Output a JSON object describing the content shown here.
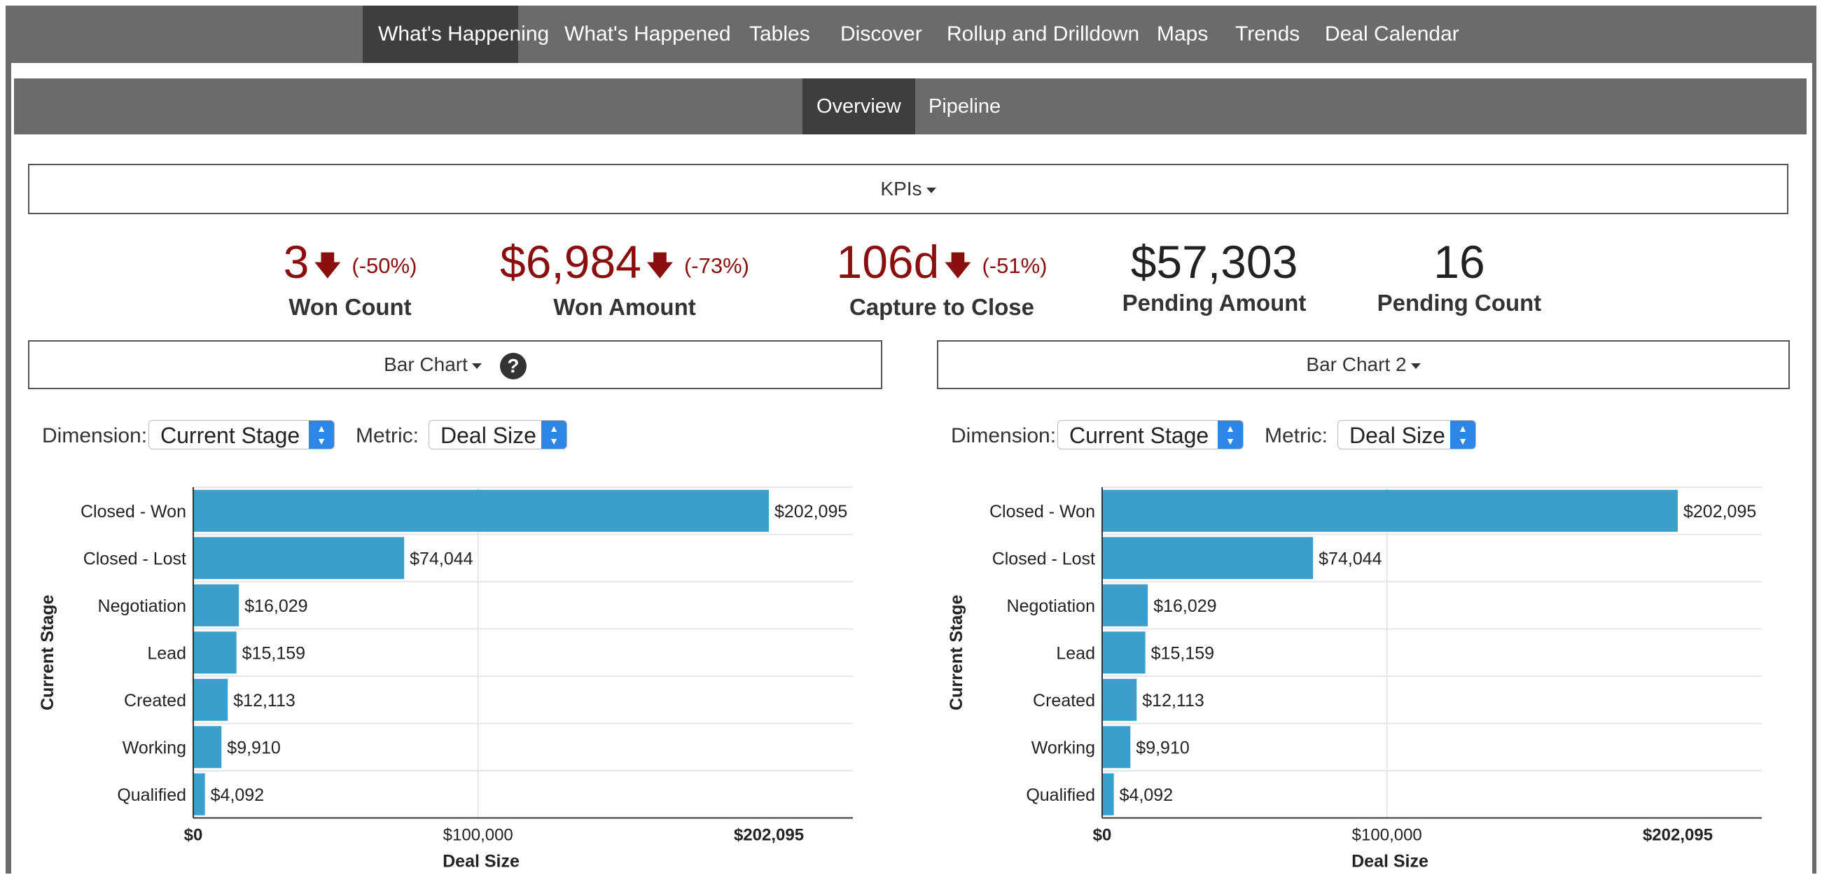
{
  "topnav": {
    "items": [
      "What's Happening",
      "What's Happened",
      "Tables",
      "Discover",
      "Rollup and Drilldown",
      "Maps",
      "Trends",
      "Deal Calendar"
    ]
  },
  "subnav": {
    "items": [
      "Overview",
      "Pipeline"
    ]
  },
  "kpis_header": "KPIs",
  "kpis": [
    {
      "value": "3",
      "pct": "(-50%)",
      "label": "Won Count"
    },
    {
      "value": "$6,984",
      "pct": "(-73%)",
      "label": "Won Amount"
    },
    {
      "value": "106d",
      "pct": "(-51%)",
      "label": "Capture to Close"
    },
    {
      "value": "$57,303",
      "pct": "",
      "label": "Pending Amount"
    },
    {
      "value": "16",
      "pct": "",
      "label": "Pending Count"
    }
  ],
  "controls": {
    "dimension_label": "Dimension:",
    "dimension_value": "Current Stage",
    "metric_label": "Metric:",
    "metric_value": "Deal Size"
  },
  "icons": {
    "help": "question-circle-icon",
    "down_arrow": "arrow-down-icon",
    "dropdown": "caret-down-icon"
  },
  "colors": {
    "bar": "#3a9fcb",
    "negative": "#8b0e0e",
    "nav_bg": "#6b6b6b",
    "nav_active": "#3e3e3e"
  },
  "chart_data": [
    {
      "type": "bar",
      "title": "Bar Chart",
      "orientation": "horizontal",
      "categories": [
        "Closed - Won",
        "Closed - Lost",
        "Negotiation",
        "Lead",
        "Created",
        "Working",
        "Qualified"
      ],
      "values": [
        202095,
        74044,
        16029,
        15159,
        12113,
        9910,
        4092
      ],
      "value_labels": [
        "$202,095",
        "$74,044",
        "$16,029",
        "$15,159",
        "$12,113",
        "$9,910",
        "$4,092"
      ],
      "xlabel": "Deal Size",
      "ylabel": "Current Stage",
      "xlim": [
        0,
        202095
      ],
      "x_ticks": [
        "$0",
        "$100,000",
        "$202,095"
      ],
      "grid": true
    },
    {
      "type": "bar",
      "title": "Bar Chart 2",
      "orientation": "horizontal",
      "categories": [
        "Closed - Won",
        "Closed - Lost",
        "Negotiation",
        "Lead",
        "Created",
        "Working",
        "Qualified"
      ],
      "values": [
        202095,
        74044,
        16029,
        15159,
        12113,
        9910,
        4092
      ],
      "value_labels": [
        "$202,095",
        "$74,044",
        "$16,029",
        "$15,159",
        "$12,113",
        "$9,910",
        "$4,092"
      ],
      "xlabel": "Deal Size",
      "ylabel": "Current Stage",
      "xlim": [
        0,
        202095
      ],
      "x_ticks": [
        "$0",
        "$100,000",
        "$202,095"
      ],
      "grid": true
    }
  ]
}
